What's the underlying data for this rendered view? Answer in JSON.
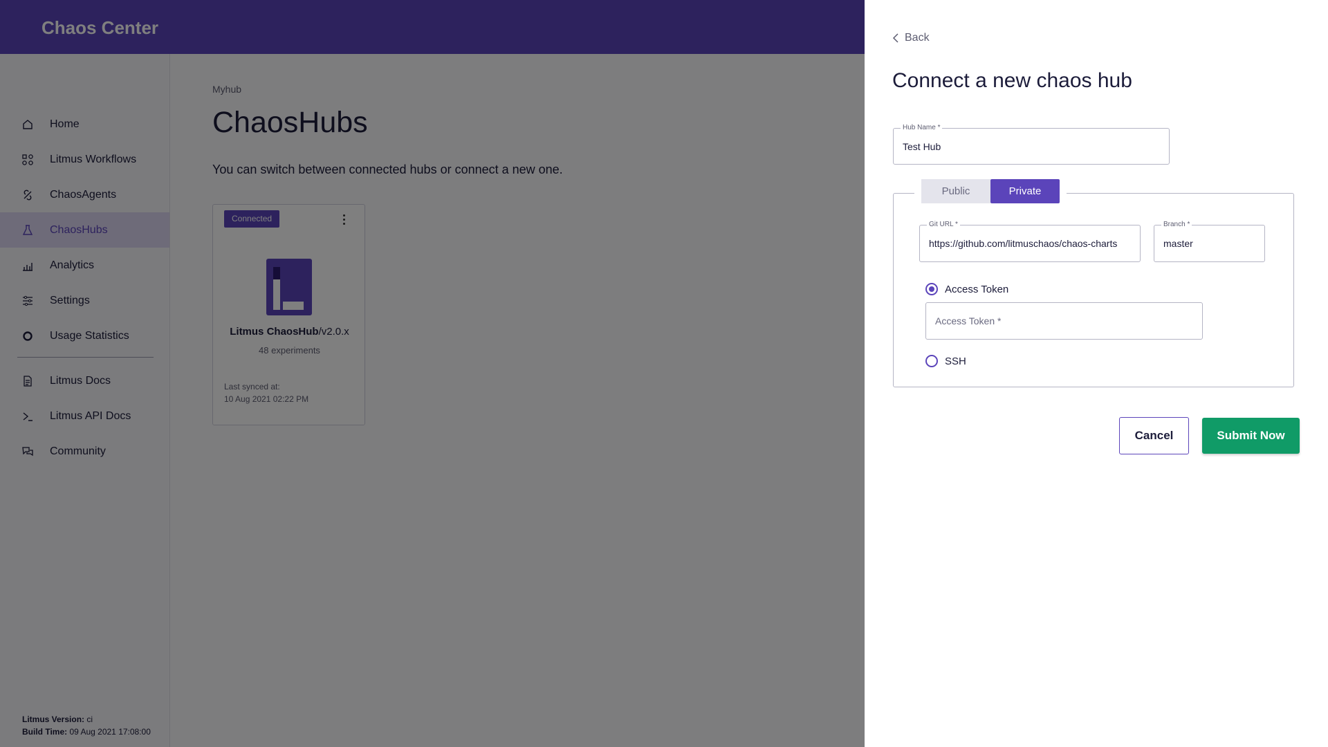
{
  "app": {
    "brand": "Chaos Center"
  },
  "sidebar": {
    "items": [
      {
        "label": "Home",
        "icon": "home-icon"
      },
      {
        "label": "Litmus Workflows",
        "icon": "workflow-icon"
      },
      {
        "label": "ChaosAgents",
        "icon": "agent-icon"
      },
      {
        "label": "ChaosHubs",
        "icon": "flask-icon",
        "active": true
      },
      {
        "label": "Analytics",
        "icon": "analytics-icon"
      },
      {
        "label": "Settings",
        "icon": "settings-icon"
      },
      {
        "label": "Usage Statistics",
        "icon": "usage-icon"
      },
      {
        "label": "Litmus Docs",
        "icon": "docs-icon"
      },
      {
        "label": "Litmus API Docs",
        "icon": "terminal-icon"
      },
      {
        "label": "Community",
        "icon": "community-icon"
      }
    ],
    "version_label": "Litmus Version:",
    "version_value": " ci",
    "build_label": "Build Time:",
    "build_value": " 09 Aug 2021 17:08:00"
  },
  "main": {
    "breadcrumb": "Myhub",
    "title": "ChaosHubs",
    "subtitle": "You can switch between connected hubs or connect a new one.",
    "hub_card": {
      "badge": "Connected",
      "name_bold": "Litmus ChaosHub",
      "name_rest": "/v2.0.x",
      "experiments": "48 experiments",
      "last_synced_label": "Last synced at:",
      "last_synced_value": "10 Aug 2021 02:22 PM"
    }
  },
  "drawer": {
    "back_label": "Back",
    "title": "Connect a new chaos hub",
    "hub_name": {
      "label": "Hub Name *",
      "value": "Test Hub"
    },
    "visibility": {
      "options": [
        "Public",
        "Private"
      ],
      "selected": "Private"
    },
    "git_url": {
      "label": "Git URL *",
      "value": "https://github.com/litmuschaos/chaos-charts"
    },
    "branch": {
      "label": "Branch *",
      "value": "master"
    },
    "auth": {
      "access_token_label": "Access Token",
      "access_token_placeholder": "Access Token *",
      "ssh_label": "SSH",
      "selected": "Access Token"
    },
    "cancel_label": "Cancel",
    "submit_label": "Submit Now"
  },
  "colors": {
    "brand": "#5b44ba",
    "submit": "#109b67",
    "overlay": "rgba(0,0,0,0.5)"
  }
}
